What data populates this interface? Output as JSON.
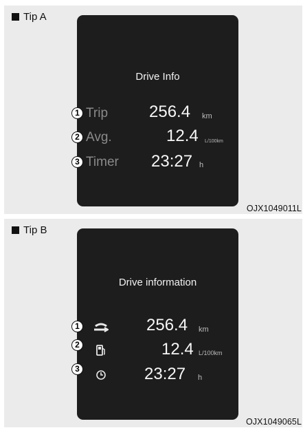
{
  "tip_a": {
    "label": "Tip A",
    "title": "Drive Info",
    "caption": "OJX1049011L",
    "rows": [
      {
        "num": "1",
        "label": "Trip",
        "value": "256.4",
        "unit": "km"
      },
      {
        "num": "2",
        "label": "Avg.",
        "value": "12.4",
        "unit": "L/100km"
      },
      {
        "num": "3",
        "label": "Timer",
        "value": "23:27",
        "unit": "h"
      }
    ]
  },
  "tip_b": {
    "label": "Tip B",
    "title": "Drive information",
    "caption": "OJX1049065L",
    "rows": [
      {
        "num": "1",
        "icon": "road-icon",
        "value": "256.4",
        "unit": "km"
      },
      {
        "num": "2",
        "icon": "fuel-pump-icon",
        "value": "12.4",
        "unit": "L/100km"
      },
      {
        "num": "3",
        "icon": "clock-icon",
        "value": "23:27",
        "unit": "h"
      }
    ]
  }
}
